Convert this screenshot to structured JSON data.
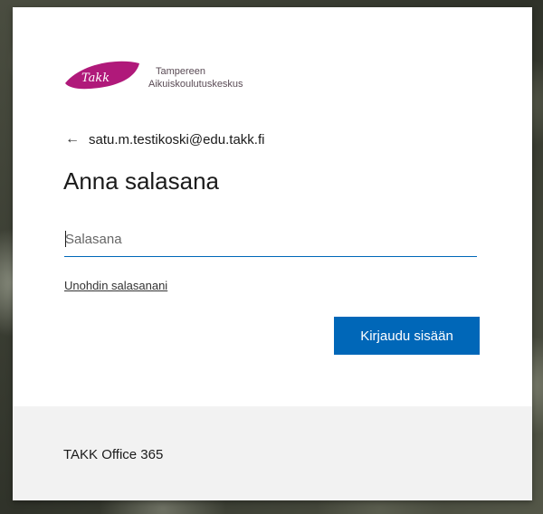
{
  "logo": {
    "mark_text": "Takk",
    "line1": "Tampereen",
    "line2": "Aikuiskoulutuskeskus",
    "brand_color": "#b0197a"
  },
  "identity": {
    "back_icon": "arrow-left-icon",
    "email": "satu.m.testikoski@edu.takk.fi"
  },
  "form": {
    "title": "Anna salasana",
    "password_placeholder": "Salasana",
    "password_value": "",
    "forgot_link": "Unohdin salasanani",
    "submit_label": "Kirjaudu sisään"
  },
  "footer": {
    "text": "TAKK Office 365"
  },
  "colors": {
    "accent": "#0067b8",
    "footer_bg": "#f2f2f2"
  }
}
